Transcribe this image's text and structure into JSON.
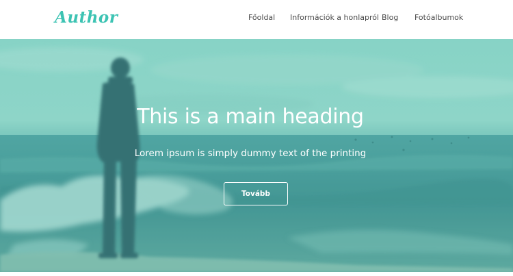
{
  "header": {
    "logo_text": "Author",
    "nav": [
      {
        "label": "Főoldal"
      },
      {
        "label": "Információk a honlapról"
      },
      {
        "label": "Blog"
      },
      {
        "label": "Fotóalbumok"
      }
    ]
  },
  "hero": {
    "title": "This is a main heading",
    "subtitle": "Lorem ipsum is simply dummy text of the printing",
    "button_label": "Tovább"
  },
  "colors": {
    "brand": "#3cc3b3",
    "nav_text": "#4a4a4a",
    "hero_tint": "#8fd4c8"
  }
}
